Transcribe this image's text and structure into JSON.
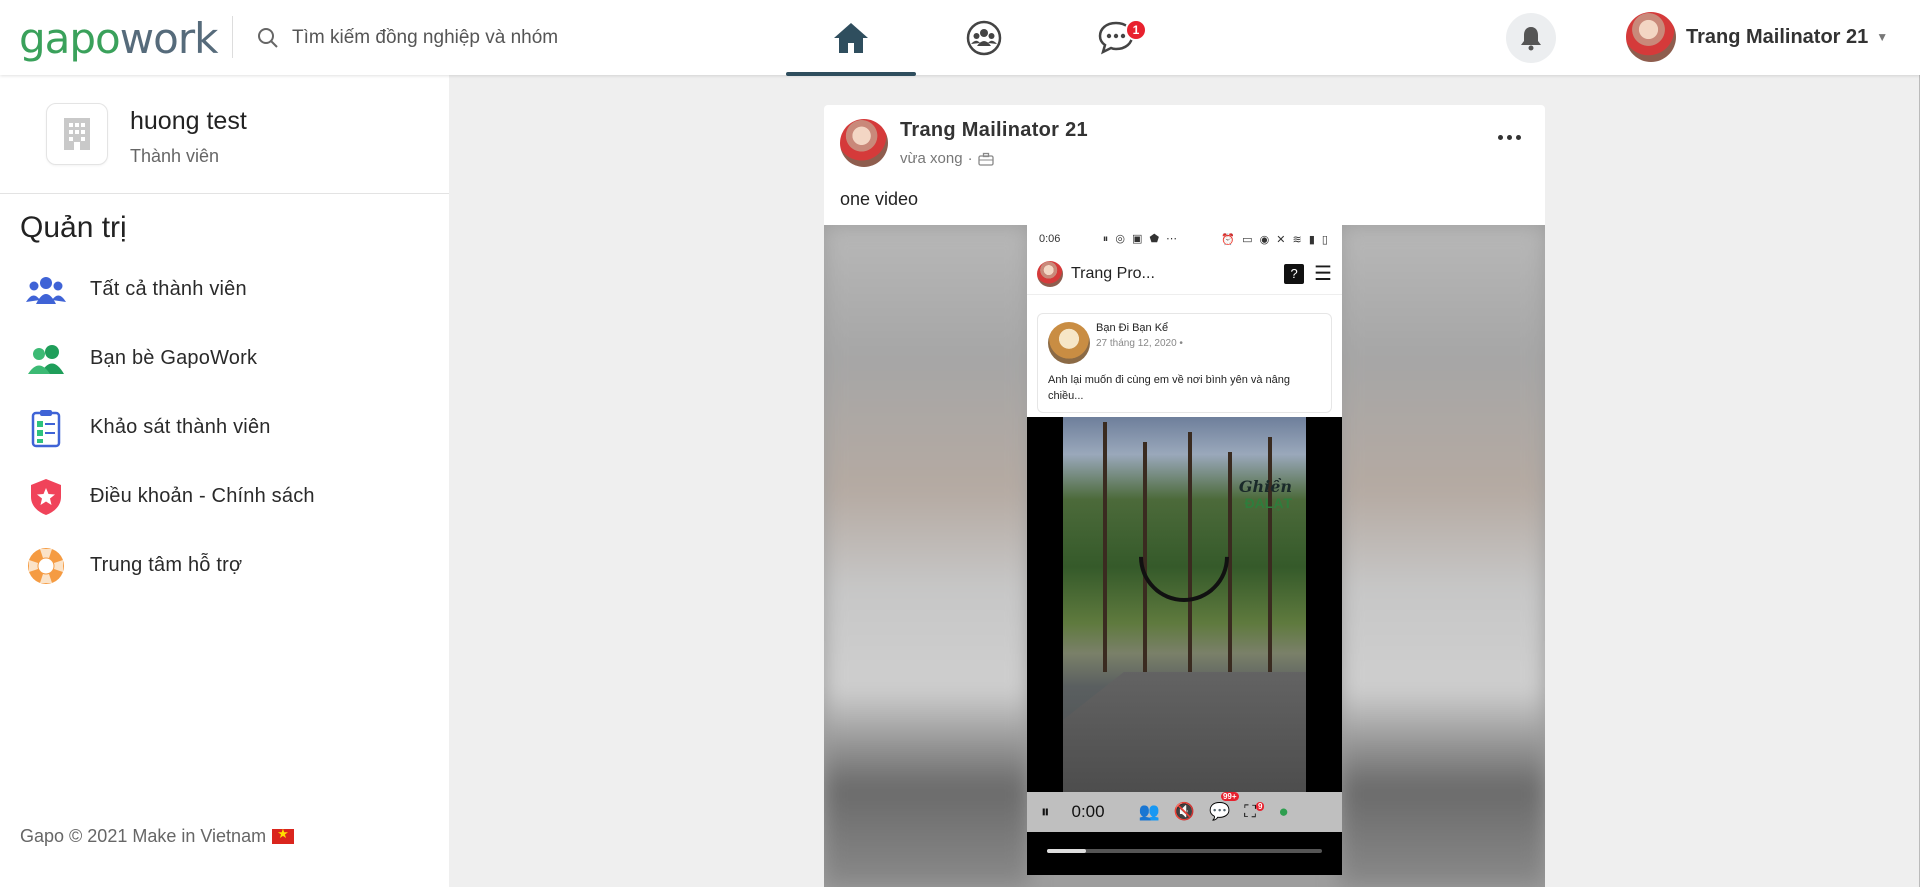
{
  "topbar": {
    "logo_g": "gapo",
    "logo_w": "work",
    "search_placeholder": "Tìm kiếm đồng nghiệp và nhóm",
    "messages_badge": "1",
    "user_name": "Trang Mailinator 21"
  },
  "sidebar": {
    "org_name": "huong test",
    "org_role": "Thành viên",
    "admin_title": "Quản trị",
    "items": [
      {
        "label": "Tất cả thành viên",
        "icon": "members-icon"
      },
      {
        "label": "Bạn bè GapoWork",
        "icon": "friends-icon"
      },
      {
        "label": "Khảo sát thành viên",
        "icon": "survey-icon"
      },
      {
        "label": "Điều khoản - Chính sách",
        "icon": "policy-shield-icon"
      },
      {
        "label": "Trung tâm hỗ trợ",
        "icon": "lifebuoy-icon"
      }
    ],
    "copyright": "Gapo © 2021 Make in Vietnam"
  },
  "post": {
    "author": "Trang Mailinator 21",
    "time": "vừa xong",
    "text": "one video",
    "video": {
      "status_time": "0:06",
      "app_title": "Trang Pro...",
      "card_author": "Bạn Đi Bạn Kể",
      "card_date": "27 tháng 12, 2020 •",
      "card_text": "Anh lại muốn đi cùng em về nơi bình yên và nâng chiều...",
      "overlay_title": "Ghiền",
      "overlay_sub": "ĐALẠT",
      "time_display": "0:00",
      "badge_1": "99+",
      "badge_2": "9",
      "progress": 0.14
    }
  },
  "colors": {
    "brand_green": "#3aa15b",
    "brand_gray": "#566b7b",
    "badge_red": "#e8212e",
    "active_tab": "#2f4e5e"
  }
}
